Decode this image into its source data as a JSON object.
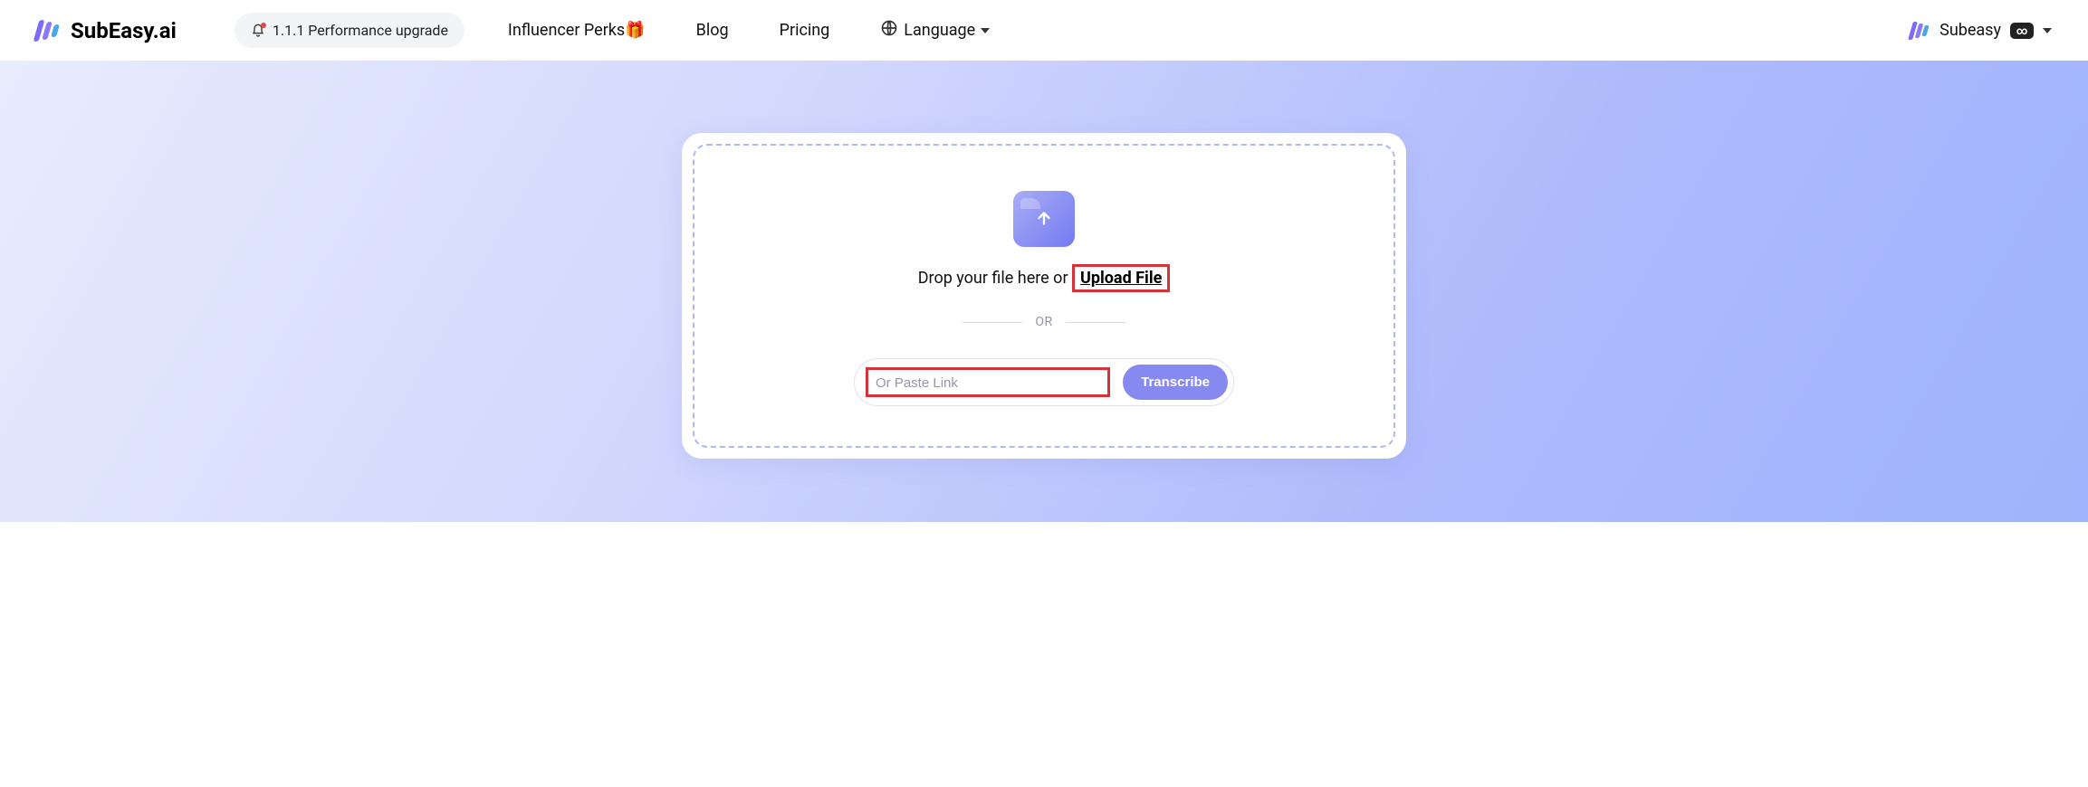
{
  "header": {
    "logo_text": "SubEasy.ai",
    "upgrade_label": "1.1.1 Performance upgrade",
    "nav": {
      "influencer": "Influencer Perks🎁",
      "blog": "Blog",
      "pricing": "Pricing",
      "language": "Language"
    },
    "account_name": "Subeasy"
  },
  "upload": {
    "drop_prefix": "Drop your file here or",
    "upload_link": "Upload File",
    "or_label": "OR",
    "paste_placeholder": "Or Paste Link",
    "transcribe_label": "Transcribe"
  }
}
